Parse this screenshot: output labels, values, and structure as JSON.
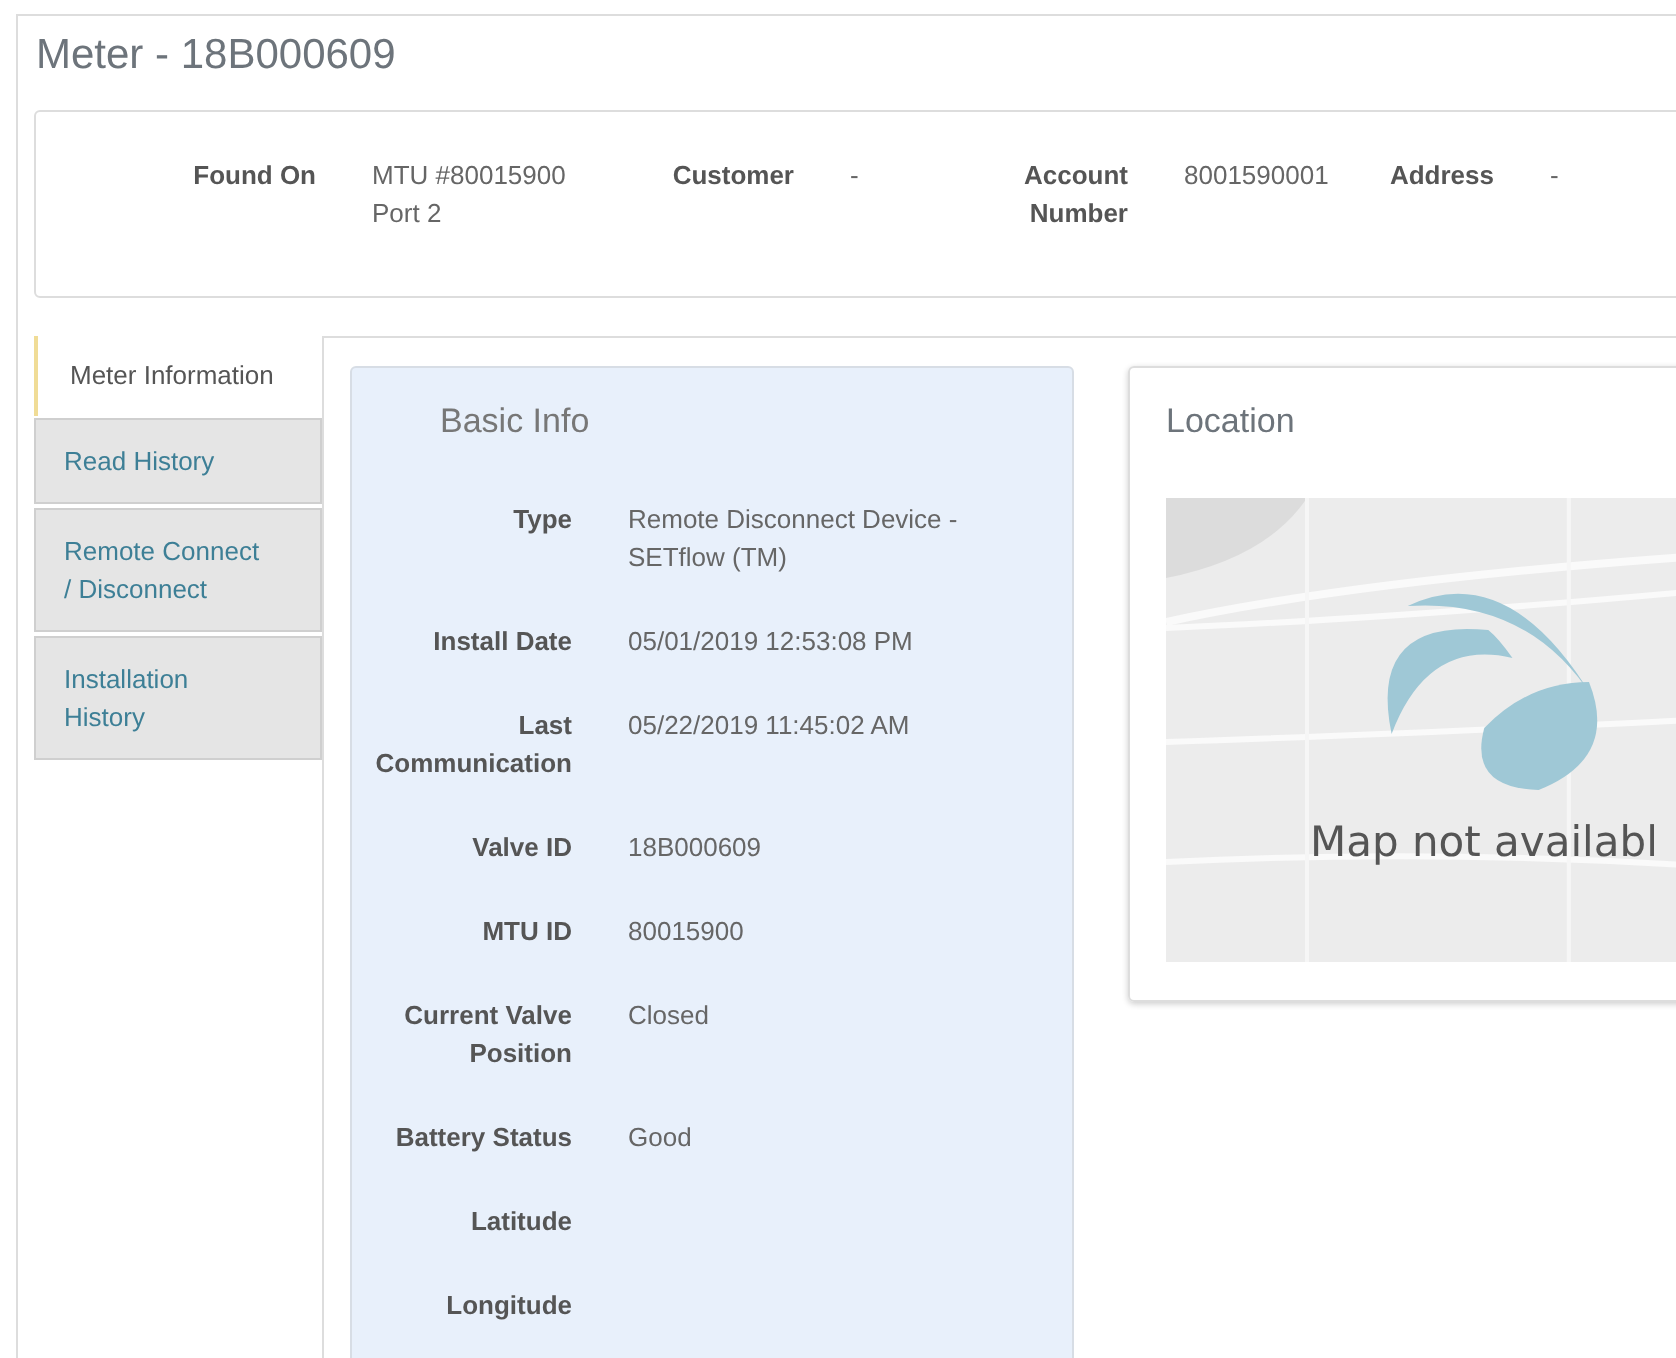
{
  "page_title": "Meter - 18B000609",
  "summary": [
    {
      "label": "Found On",
      "value": [
        "MTU #80015900",
        "Port 2"
      ]
    },
    {
      "label": "Customer",
      "value": [
        "-"
      ]
    },
    {
      "label": "Account Number",
      "value": [
        "8001590001"
      ]
    },
    {
      "label": "Address",
      "value": [
        "-"
      ]
    }
  ],
  "tabs": [
    {
      "label": "Meter Information",
      "selected": true
    },
    {
      "label": "Read History",
      "selected": false
    },
    {
      "label": "Remote Connect / Disconnect",
      "selected": false
    },
    {
      "label": "Installation History",
      "selected": false
    }
  ],
  "basic_info": {
    "title": "Basic Info",
    "fields": [
      {
        "label": "Type",
        "value": "Remote Disconnect Device - SETflow (TM)"
      },
      {
        "label": "Install Date",
        "value": "05/01/2019 12:53:08 PM"
      },
      {
        "label": "Last Communication",
        "value": "05/22/2019 11:45:02 AM"
      },
      {
        "label": "Valve ID",
        "value": "18B000609"
      },
      {
        "label": "MTU ID",
        "value": "80015900"
      },
      {
        "label": "Current Valve Position",
        "value": "Closed"
      },
      {
        "label": "Battery Status",
        "value": "Good"
      },
      {
        "label": "Latitude"
      },
      {
        "label": "Longitude"
      }
    ]
  },
  "location": {
    "title": "Location",
    "map": {
      "kind": "picture",
      "message": "Map not availabl"
    }
  }
}
